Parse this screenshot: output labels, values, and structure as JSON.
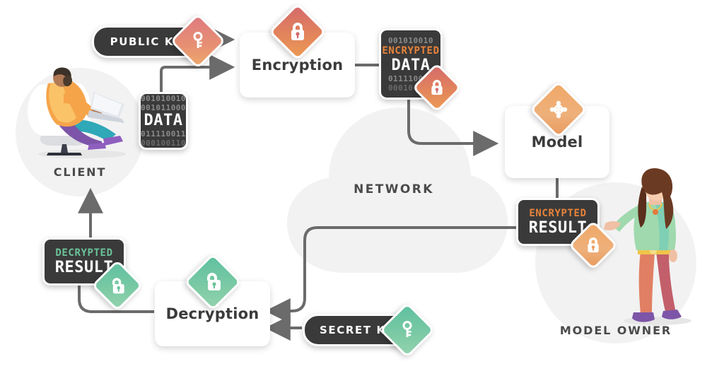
{
  "diagram": {
    "title_region": "homomorphic-encryption-flow"
  },
  "nodes": {
    "public_key": {
      "label": "PUBLIC KEY",
      "icon": "key-icon",
      "color": "#e08a6e"
    },
    "secret_key": {
      "label": "SECRET KEY",
      "icon": "key-icon",
      "color": "#6cc39a"
    },
    "encryption": {
      "label": "Encryption",
      "icon": "closed-padlock-icon",
      "color": "#dd7a63"
    },
    "decryption": {
      "label": "Decryption",
      "icon": "open-padlock-icon",
      "color": "#6cc39a"
    },
    "model": {
      "label": "Model",
      "icon": "neural-network-icon",
      "color": "#efa86a"
    }
  },
  "data_block": {
    "line1": "001010010",
    "line2": "001011000",
    "word": "DATA",
    "line3": "011110011",
    "line4": "000100110"
  },
  "encrypted_data_block": {
    "line1": "001010010",
    "tag": "ENCRYPTED",
    "word": "DATA",
    "line3": "011110011",
    "line4": "000100110",
    "tag_color": "#e8833a",
    "icon": "closed-padlock-icon"
  },
  "encrypted_result_block": {
    "tag": "ENCRYPTED",
    "word": "RESULT",
    "tag_color": "#e8833a",
    "icon": "closed-padlock-icon"
  },
  "decrypted_result_block": {
    "tag": "DECRYPTED",
    "word": "RESULT",
    "tag_color": "#6cc39a",
    "icon": "open-padlock-icon"
  },
  "regions": {
    "client": {
      "label": "CLIENT",
      "illustration": "man-with-laptop-in-chair"
    },
    "network": {
      "label": "NETWORK",
      "illustration": "cloud-shape"
    },
    "model_owner": {
      "label": "MODEL OWNER",
      "illustration": "woman-presenting"
    }
  },
  "colors": {
    "background": "#ffffff",
    "surface_gray": "#f2f2f2",
    "dark_tile": "#3a3a3a",
    "arrow": "#6b6b6b",
    "text_dark": "#3b3b3b"
  }
}
